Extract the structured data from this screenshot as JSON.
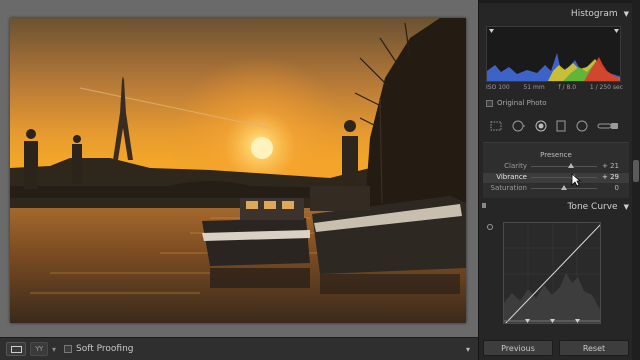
{
  "toolbar": {
    "soft_proofing_label": "Soft Proofing",
    "view_button_icon": "loupe-view-icon",
    "compare_button_label": "YY",
    "left_caret": "▾",
    "right_caret": "▾"
  },
  "histogram": {
    "title": "Histogram",
    "iso": "ISO 100",
    "focal_length": "51 mm",
    "aperture": "f / 8.0",
    "shutter": "1 / 250 sec",
    "original_photo_label": "Original Photo"
  },
  "tools": [
    "crop-icon",
    "spot-removal-icon",
    "red-eye-icon",
    "graduated-filter-icon",
    "radial-filter-icon",
    "adjustment-brush-icon"
  ],
  "presence": {
    "title": "Presence",
    "sliders": [
      {
        "label": "Clarity",
        "value_text": "+ 21",
        "value": 21
      },
      {
        "label": "Vibrance",
        "value_text": "+ 29",
        "value": 29
      },
      {
        "label": "Saturation",
        "value_text": "0",
        "value": 0
      }
    ]
  },
  "tone_curve": {
    "title": "Tone Curve"
  },
  "buttons": {
    "previous": "Previous",
    "reset": "Reset"
  },
  "colors": {
    "panel_bg": "#262626",
    "photo_bg": "#6a6a6a",
    "sun": "#fff2b0",
    "sky_top": "#7a5a36",
    "sky_horizon": "#f2a128"
  }
}
